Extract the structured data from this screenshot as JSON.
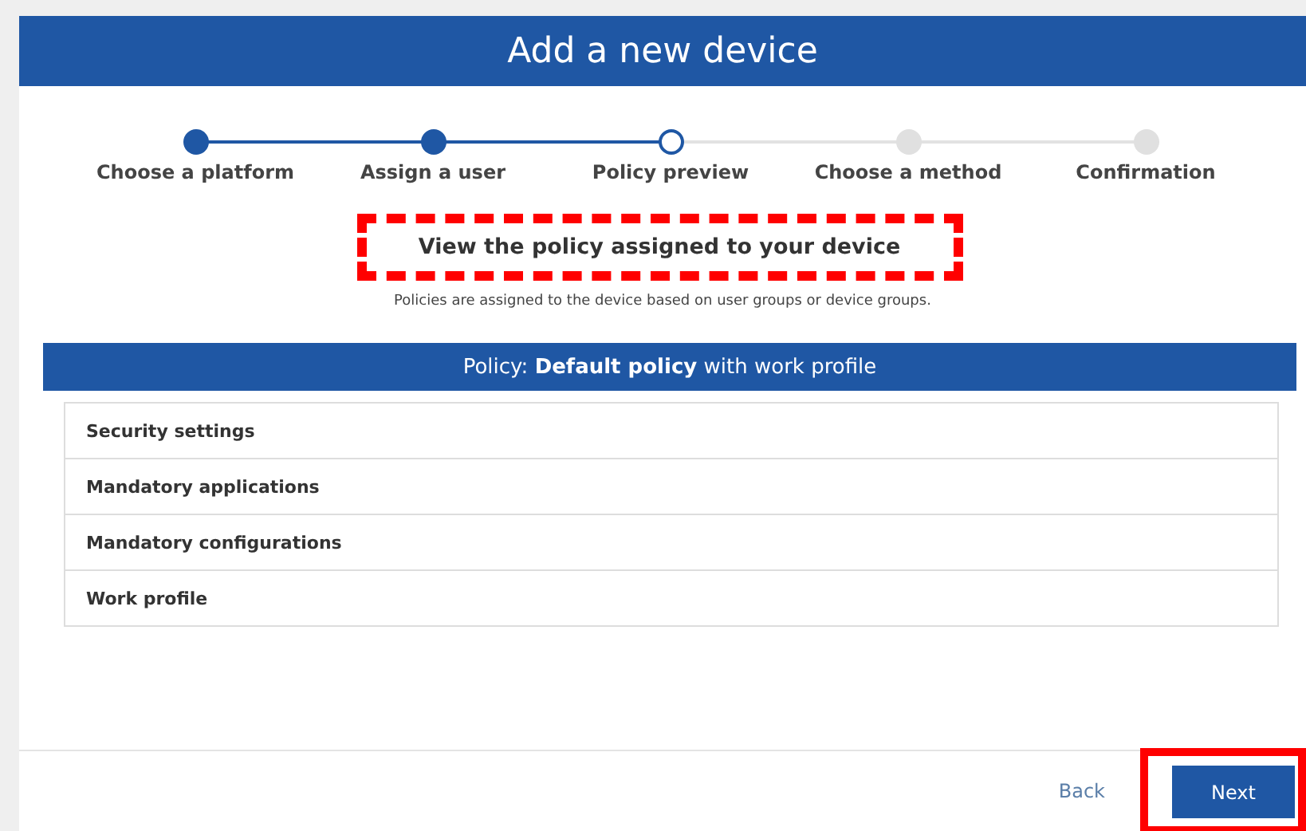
{
  "dialog": {
    "title": "Add a new device"
  },
  "steps": [
    {
      "label": "Choose a platform",
      "kind": "done"
    },
    {
      "label": "Assign a user",
      "kind": "done"
    },
    {
      "label": "Policy preview",
      "kind": "current"
    },
    {
      "label": "Choose a method",
      "kind": "pending"
    },
    {
      "label": "Confirmation",
      "kind": "pending"
    }
  ],
  "heading": "View the policy assigned to your device",
  "subheading": "Policies are assigned to the device based on user groups or device groups.",
  "policy_banner": "Policy: **Default policy** with work profile",
  "sections": [
    {
      "label": "Security settings"
    },
    {
      "label": "Mandatory applications"
    },
    {
      "label": "Mandatory configurations"
    },
    {
      "label": "Work profile"
    }
  ],
  "footer": {
    "back": "Back",
    "next": "Next"
  }
}
